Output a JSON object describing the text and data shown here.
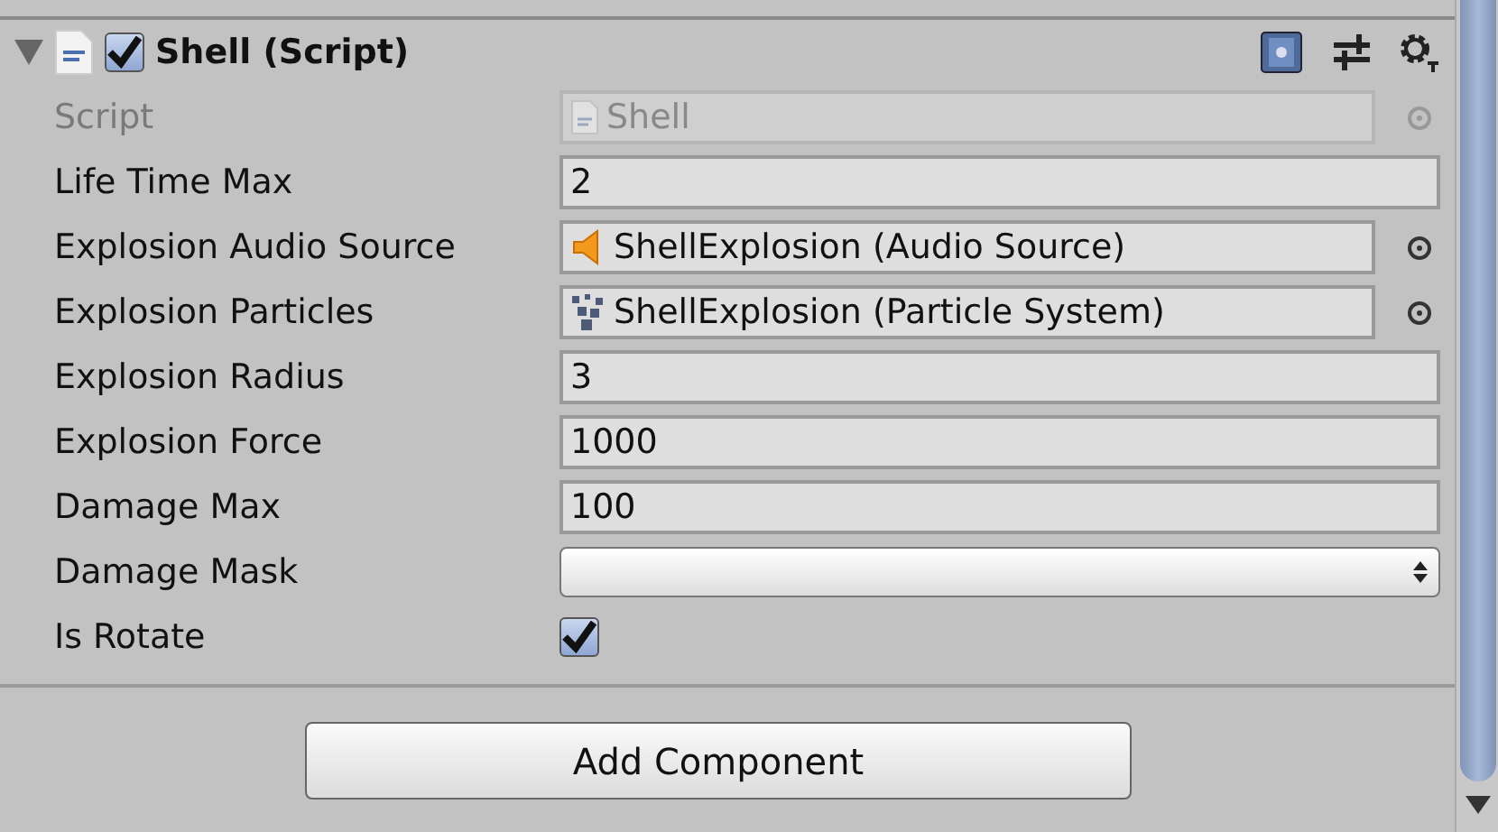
{
  "component": {
    "title": "Shell (Script)",
    "expanded": true,
    "enabled": true
  },
  "fields": [
    {
      "label": "Script",
      "kind": "script",
      "value": "Shell",
      "disabled": true
    },
    {
      "label": "Life Time Max",
      "kind": "number",
      "value": "2",
      "disabled": false
    },
    {
      "label": "Explosion Audio Source",
      "kind": "audio",
      "value": "ShellExplosion (Audio Source)",
      "disabled": false
    },
    {
      "label": "Explosion Particles",
      "kind": "particles",
      "value": "ShellExplosion (Particle System)",
      "disabled": false
    },
    {
      "label": "Explosion Radius",
      "kind": "number",
      "value": "3",
      "disabled": false
    },
    {
      "label": "Explosion Force",
      "kind": "number",
      "value": "1000",
      "disabled": false
    },
    {
      "label": "Damage Max",
      "kind": "number",
      "value": "100",
      "disabled": false
    },
    {
      "label": "Damage Mask",
      "kind": "dropdown",
      "disabled": false
    },
    {
      "label": "Is Rotate",
      "kind": "checkbox",
      "checked": true,
      "disabled": false
    }
  ],
  "add_button": "Add Component"
}
